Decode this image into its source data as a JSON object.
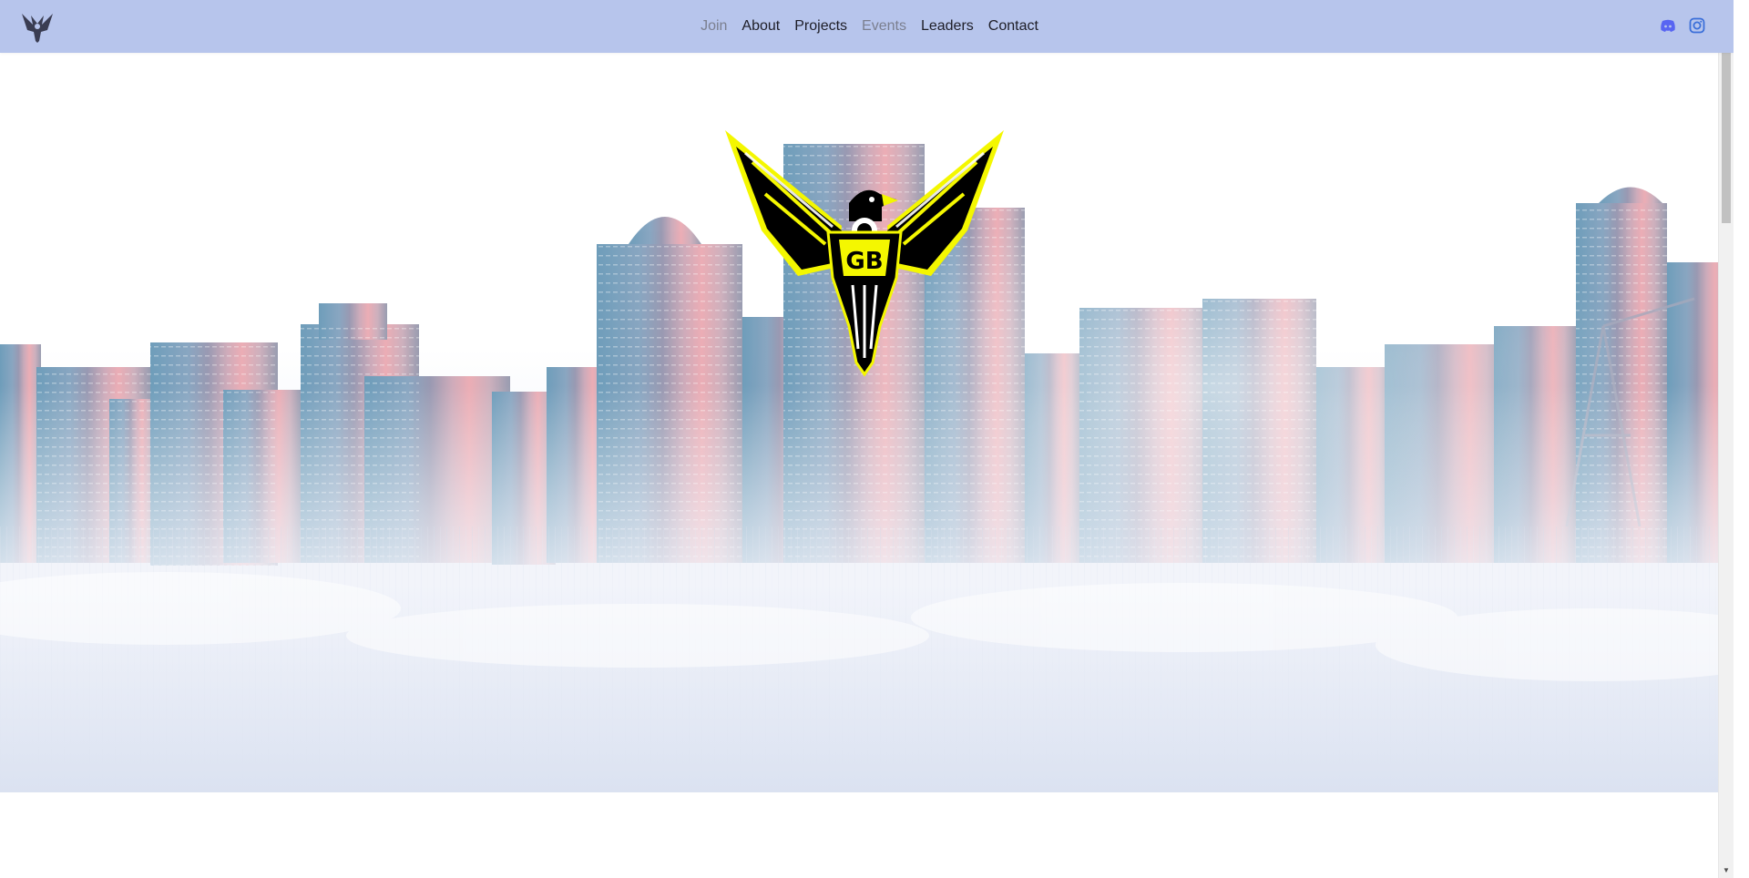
{
  "navbar": {
    "brand_icon": "eagle-logo-icon",
    "links": [
      {
        "label": "Join",
        "state": "muted"
      },
      {
        "label": "About",
        "state": "normal"
      },
      {
        "label": "Projects",
        "state": "normal"
      },
      {
        "label": "Events",
        "state": "muted"
      },
      {
        "label": "Leaders",
        "state": "normal"
      },
      {
        "label": "Contact",
        "state": "normal"
      }
    ],
    "social": [
      {
        "icon": "discord-icon",
        "color": "#5865F2"
      },
      {
        "icon": "instagram-icon",
        "color": "#3b6fd9"
      }
    ]
  },
  "hero": {
    "emblem_icon": "eagle-emblem-icon",
    "emblem_colors": {
      "primary": "#000000",
      "accent": "#f4f700"
    }
  },
  "colors": {
    "navbar_bg": "#b7c5ec",
    "skyline_blue": "#5a8fb0",
    "skyline_pink": "#e89aa4",
    "mist": "#dbe2f1"
  }
}
